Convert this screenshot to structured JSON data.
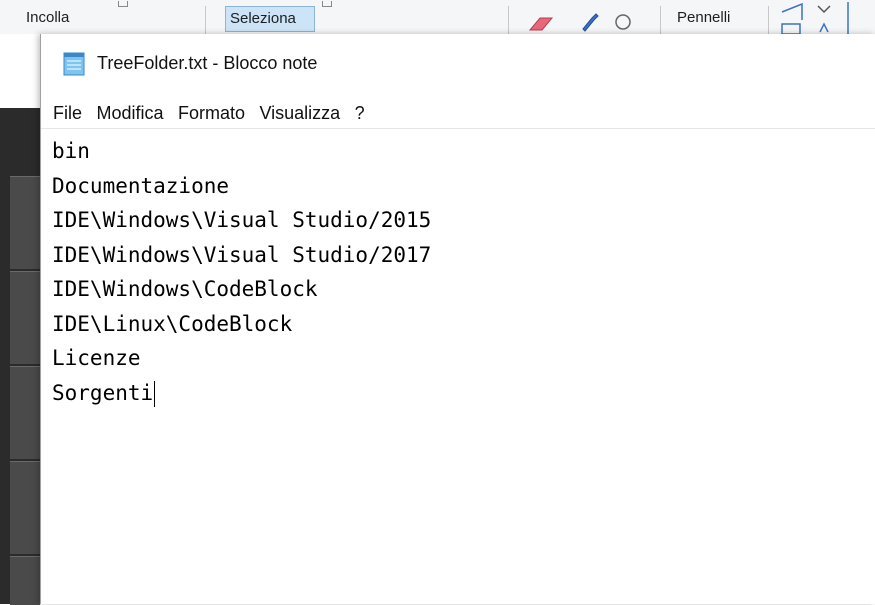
{
  "ribbon": {
    "incolla_label": "Incolla",
    "seleziona_label": "Seleziona",
    "pennelli_label": "Pennelli",
    "icons": [
      "paste-icon",
      "select-icon",
      "eraser-icon",
      "color-picker-icon",
      "magnifier-icon",
      "shapes-icon"
    ]
  },
  "notepad": {
    "title": "TreeFolder.txt - Blocco note",
    "app_icon": "notepad-icon",
    "menu": [
      "File",
      "Modifica",
      "Formato",
      "Visualizza",
      "?"
    ],
    "lines": [
      "bin",
      "Documentazione",
      "IDE\\Windows\\Visual Studio/2015",
      "IDE\\Windows\\Visual Studio/2017",
      "IDE\\Windows\\CodeBlock",
      "IDE\\Linux\\CodeBlock",
      "Licenze",
      "Sorgenti"
    ]
  },
  "colors": {
    "ribbon_bg": "#f5f6f7",
    "selected_tool_bg": "#cce4f7",
    "background_dark": "#2b2b2b"
  }
}
